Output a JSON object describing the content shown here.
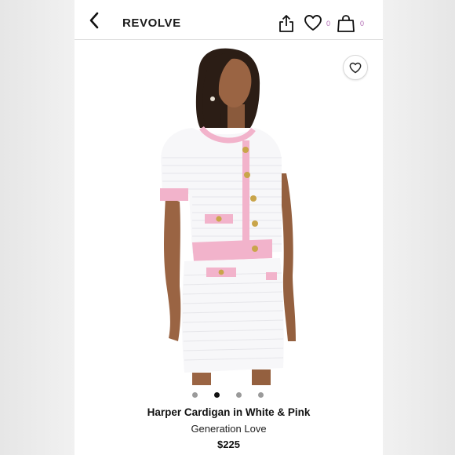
{
  "header": {
    "logo": "REVOLVE",
    "wishlist_count": "0",
    "bag_count": "0",
    "icons": [
      "chevron-left-icon",
      "share-icon",
      "heart-icon",
      "shopping-bag-icon"
    ]
  },
  "gallery": {
    "image_description_icon": "model-photo",
    "active_index": 2,
    "dot_count": 4
  },
  "product": {
    "title": "Harper Cardigan in White & Pink",
    "brand": "Generation Love",
    "price": "$225"
  },
  "colors": {
    "accent_count": "#b26bb4",
    "pink_trim": "#f2b3cb",
    "gold_button": "#c9a54a"
  }
}
